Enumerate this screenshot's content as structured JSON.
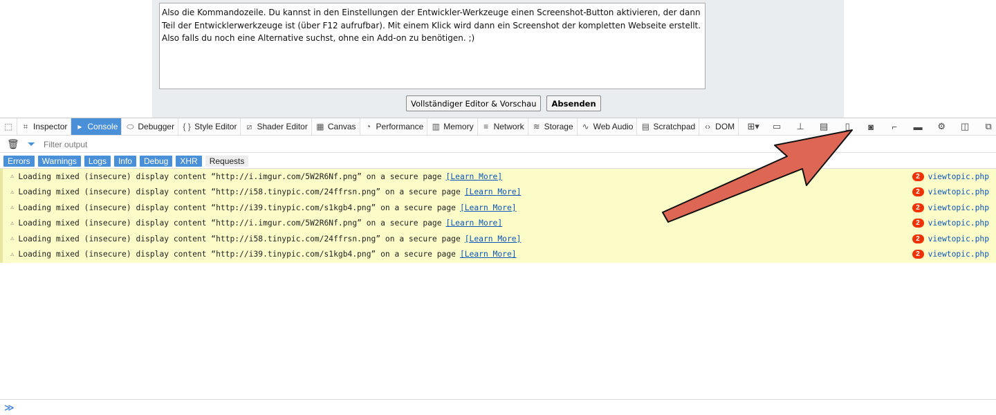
{
  "post": {
    "text": "Also die Kommandozeile. Du kannst in den Einstellungen der Entwickler-Werkzeuge einen Screenshot-Button aktivieren, der dann Teil der Entwicklerwerkzeuge ist (über F12 aufrufbar). Mit einem Klick wird dann ein Screenshot der kompletten Webseite erstellt. Also falls du noch eine Alternative suchst, ohne ein Add-on zu benötigen. ;)",
    "preview_label": "Vollständiger Editor & Vorschau",
    "submit_label": "Absenden"
  },
  "tabs": [
    {
      "label": "Inspector",
      "icon": "inspector-icon"
    },
    {
      "label": "Console",
      "icon": "console-icon"
    },
    {
      "label": "Debugger",
      "icon": "debugger-icon"
    },
    {
      "label": "Style Editor",
      "icon": "braces-icon"
    },
    {
      "label": "Shader Editor",
      "icon": "shader-icon"
    },
    {
      "label": "Canvas",
      "icon": "canvas-icon"
    },
    {
      "label": "Performance",
      "icon": "performance-icon"
    },
    {
      "label": "Memory",
      "icon": "memory-icon"
    },
    {
      "label": "Network",
      "icon": "network-icon"
    },
    {
      "label": "Storage",
      "icon": "storage-icon"
    },
    {
      "label": "Web Audio",
      "icon": "wave-icon"
    },
    {
      "label": "Scratchpad",
      "icon": "scratchpad-icon"
    },
    {
      "label": "DOM",
      "icon": "dom-icon"
    }
  ],
  "filter": {
    "placeholder": "Filter output"
  },
  "categories": [
    "Errors",
    "Warnings",
    "Logs",
    "Info",
    "Debug",
    "XHR",
    "Requests"
  ],
  "messages": [
    {
      "text": "Loading mixed (insecure) display content “http://i.imgur.com/5W2R6Nf.png” on a secure page",
      "link": "[Learn More]",
      "count": "2",
      "source": "viewtopic.php"
    },
    {
      "text": "Loading mixed (insecure) display content “http://i58.tinypic.com/24ffrsn.png” on a secure page",
      "link": "[Learn More]",
      "count": "2",
      "source": "viewtopic.php"
    },
    {
      "text": "Loading mixed (insecure) display content “http://i39.tinypic.com/s1kgb4.png” on a secure page",
      "link": "[Learn More]",
      "count": "2",
      "source": "viewtopic.php"
    },
    {
      "text": "Loading mixed (insecure) display content “http://i.imgur.com/5W2R6Nf.png” on a secure page",
      "link": "[Learn More]",
      "count": "2",
      "source": "viewtopic.php"
    },
    {
      "text": "Loading mixed (insecure) display content “http://i58.tinypic.com/24ffrsn.png” on a secure page",
      "link": "[Learn More]",
      "count": "2",
      "source": "viewtopic.php"
    },
    {
      "text": "Loading mixed (insecure) display content “http://i39.tinypic.com/s1kgb4.png” on a secure page",
      "link": "[Learn More]",
      "count": "2",
      "source": "viewtopic.php"
    }
  ],
  "prompt": "≫",
  "colors": {
    "accent": "#4a90d9",
    "warning_bg": "#fcfcc8",
    "arrow": "#dd6655"
  }
}
